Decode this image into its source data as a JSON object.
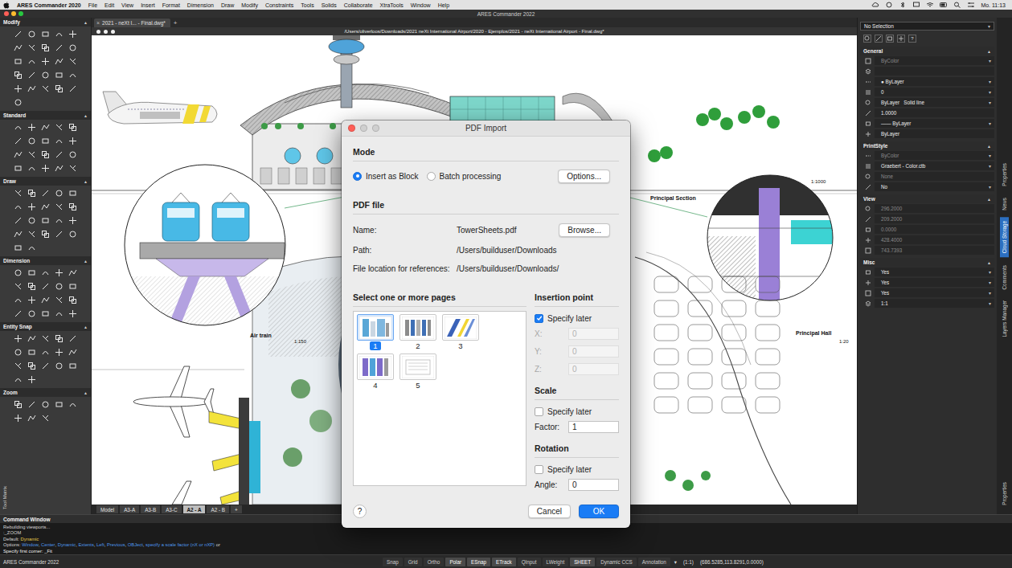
{
  "menu_bar": {
    "app": "ARES Commander 2020",
    "items": [
      "File",
      "Edit",
      "View",
      "Insert",
      "Format",
      "Dimension",
      "Draw",
      "Modify",
      "Constraints",
      "Tools",
      "Solids",
      "Collaborate",
      "XtraTools",
      "Window",
      "Help"
    ],
    "clock": "Mo. 11:13"
  },
  "window": {
    "title": "ARES Commander 2022"
  },
  "document_tabs": [
    {
      "label": "2021 - neXt I... - Final.dwg*",
      "close": "×",
      "selected": true
    }
  ],
  "new_tab": "+",
  "canvas": {
    "path": "/Users/oliverloos/Downloads/2021 neXt International Airport/2020 - Ejemplos/2021 - neXt International Airport - Final.dwg*",
    "labels": {
      "principal_section": "Principal Section",
      "principal_section_scale": "1:1000",
      "principal_hall": "Principal Hall",
      "principal_hall_scale": "1:20",
      "air_train": "Air train",
      "air_train_scale": "1:150"
    }
  },
  "tool_matrix": {
    "label": "Tool Matrix",
    "collapse": "▲",
    "sections": [
      {
        "name": "Modify",
        "tools": 26
      },
      {
        "name": "Standard",
        "tools": 20
      },
      {
        "name": "Draw",
        "tools": 22
      },
      {
        "name": "Dimension",
        "tools": 20
      },
      {
        "name": "Entity Snap",
        "tools": 17
      },
      {
        "name": "Zoom",
        "tools": 8
      }
    ]
  },
  "layout_tabs": [
    {
      "label": "Model",
      "selected": false
    },
    {
      "label": "A3-A",
      "selected": false
    },
    {
      "label": "A3-B",
      "selected": false
    },
    {
      "label": "A3-C",
      "selected": false
    },
    {
      "label": "A2 - A",
      "selected": true
    },
    {
      "label": "A2 - B",
      "selected": false
    }
  ],
  "layout_add": "+",
  "properties": {
    "selection": "No Selection",
    "dropdown_arrow": "▾",
    "collapse": "▲",
    "toolbar_help": "?",
    "sections": [
      {
        "name": "General",
        "rows": [
          {
            "value": "ByColor",
            "disabled": true,
            "dropdown": true
          },
          {
            "value": "",
            "disabled": false,
            "dropdown": false
          },
          {
            "value": "● ByLayer",
            "disabled": false,
            "dropdown": true
          },
          {
            "value": "0",
            "disabled": false,
            "dropdown": true
          },
          {
            "value": "ByLayer   Solid line",
            "disabled": false,
            "dropdown": true
          },
          {
            "value": "1.0000",
            "disabled": false,
            "dropdown": false
          },
          {
            "value": "—— ByLayer",
            "disabled": false,
            "dropdown": true
          },
          {
            "value": "ByLayer",
            "disabled": false,
            "dropdown": false
          }
        ]
      },
      {
        "name": "PrintStyle",
        "rows": [
          {
            "value": "ByColor",
            "disabled": true,
            "dropdown": true
          },
          {
            "value": "Graebert - Color.ctb",
            "disabled": false,
            "dropdown": true
          },
          {
            "value": "None",
            "disabled": true,
            "dropdown": false
          },
          {
            "value": "No",
            "disabled": false,
            "dropdown": true
          }
        ]
      },
      {
        "name": "View",
        "rows": [
          {
            "value": "296.2000",
            "disabled": true,
            "dropdown": false
          },
          {
            "value": "209.2000",
            "disabled": true,
            "dropdown": false
          },
          {
            "value": "0.0000",
            "disabled": true,
            "dropdown": false
          },
          {
            "value": "428.4000",
            "disabled": true,
            "dropdown": false
          },
          {
            "value": "743.7393",
            "disabled": true,
            "dropdown": false
          }
        ]
      },
      {
        "name": "Misc",
        "rows": [
          {
            "value": "Yes",
            "disabled": false,
            "dropdown": true
          },
          {
            "value": "Yes",
            "disabled": false,
            "dropdown": true
          },
          {
            "value": "Yes",
            "disabled": false,
            "dropdown": true
          },
          {
            "value": "1:1",
            "disabled": false,
            "dropdown": true
          }
        ]
      }
    ]
  },
  "side_tabs": [
    {
      "label": "Properties",
      "selected": false
    },
    {
      "label": "News",
      "selected": false
    },
    {
      "label": "Cloud Storage",
      "selected": true
    },
    {
      "label": "Comments",
      "selected": false
    },
    {
      "label": "Layers Manager",
      "selected": false
    }
  ],
  "side_tab_bottom": "Properties",
  "command_window": {
    "title": "Command Window",
    "lines": [
      [
        {
          "text": "Rebuilding viewports...",
          "color": "#d6d6d6"
        }
      ],
      [
        {
          "text": ":_ZOOM",
          "color": "#d6d6d6"
        }
      ],
      [
        {
          "text": "Default: ",
          "color": "#d6d6d6"
        },
        {
          "text": "Dynamic",
          "color": "#e6c84a"
        }
      ],
      [
        {
          "text": "Options: ",
          "color": "#d6d6d6"
        },
        {
          "text": "Window",
          "color": "#4f97e8"
        },
        {
          "text": ", ",
          "color": "#d6d6d6"
        },
        {
          "text": "Center",
          "color": "#4f97e8"
        },
        {
          "text": ", ",
          "color": "#d6d6d6"
        },
        {
          "text": "Dynamic",
          "color": "#4f97e8"
        },
        {
          "text": ", ",
          "color": "#d6d6d6"
        },
        {
          "text": "Extents",
          "color": "#4f97e8"
        },
        {
          "text": ", ",
          "color": "#d6d6d6"
        },
        {
          "text": "Left",
          "color": "#4f97e8"
        },
        {
          "text": ", ",
          "color": "#d6d6d6"
        },
        {
          "text": "Previous",
          "color": "#4f97e8"
        },
        {
          "text": ", ",
          "color": "#d6d6d6"
        },
        {
          "text": "OBJect",
          "color": "#4f97e8"
        },
        {
          "text": ", ",
          "color": "#d6d6d6"
        },
        {
          "text": "specify a scale factor (nX or nXP)",
          "color": "#4f97e8"
        },
        {
          "text": " or",
          "color": "#d6d6d6"
        }
      ],
      [
        {
          "text": "Specify first corner: _Fit",
          "color": "#f0f0f0"
        }
      ]
    ]
  },
  "status_bar": {
    "app": "ARES Commander 2022",
    "toggles": [
      {
        "label": "Snap",
        "on": false
      },
      {
        "label": "Grid",
        "on": false
      },
      {
        "label": "Ortho",
        "on": false
      },
      {
        "label": "Polar",
        "on": true
      },
      {
        "label": "ESnap",
        "on": true
      },
      {
        "label": "ETrack",
        "on": true
      },
      {
        "label": "QInput",
        "on": false
      },
      {
        "label": "LWeight",
        "on": false
      },
      {
        "label": "SHEET",
        "on": true
      },
      {
        "label": "Dynamic CCS",
        "on": false
      }
    ],
    "annotation": "Annotation",
    "annotation_arrow": "▾",
    "scale": "(1:1)",
    "coordinates": "(686.5285,113.8291,0.0000)"
  },
  "dialog": {
    "title": "PDF Import",
    "mode": {
      "heading": "Mode",
      "options": [
        {
          "label": "Insert as Block",
          "selected": true
        },
        {
          "label": "Batch processing",
          "selected": false
        }
      ],
      "button": "Options..."
    },
    "pdf_file": {
      "heading": "PDF file",
      "fields": [
        {
          "label": "Name:",
          "value": "TowerSheets.pdf",
          "button": "Browse..."
        },
        {
          "label": "Path:",
          "value": "/Users/builduser/Downloads"
        },
        {
          "label": "File location for references:",
          "value": "/Users/builduser/Downloads/"
        }
      ]
    },
    "pages": {
      "heading": "Select one or more pages",
      "items": [
        {
          "label": "1",
          "selected": true
        },
        {
          "label": "2",
          "selected": false
        },
        {
          "label": "3",
          "selected": false
        },
        {
          "label": "4",
          "selected": false
        },
        {
          "label": "5",
          "selected": false
        }
      ]
    },
    "groups": [
      {
        "heading": "Insertion point",
        "specify_later": {
          "label": "Specify later",
          "checked": true
        },
        "fields": [
          {
            "label": "X:",
            "value": "0",
            "disabled": true
          },
          {
            "label": "Y:",
            "value": "0",
            "disabled": true
          },
          {
            "label": "Z:",
            "value": "0",
            "disabled": true
          }
        ]
      },
      {
        "heading": "Scale",
        "specify_later": {
          "label": "Specify later",
          "checked": false
        },
        "fields": [
          {
            "label": "Factor:",
            "value": "1",
            "disabled": false
          }
        ]
      },
      {
        "heading": "Rotation",
        "specify_later": {
          "label": "Specify later",
          "checked": false
        },
        "fields": [
          {
            "label": "Angle:",
            "value": "0",
            "disabled": false
          }
        ]
      }
    ],
    "help": "?",
    "buttons": [
      {
        "label": "Cancel",
        "primary": false
      },
      {
        "label": "OK",
        "primary": true
      }
    ]
  }
}
